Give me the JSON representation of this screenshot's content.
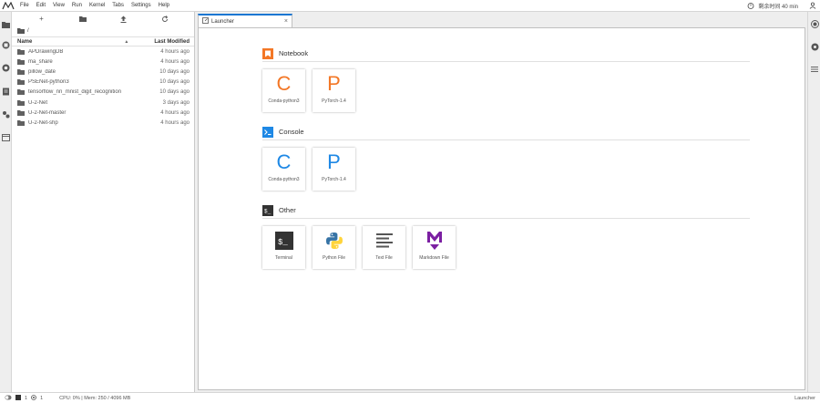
{
  "menubar": {
    "items": [
      "File",
      "Edit",
      "View",
      "Run",
      "Kernel",
      "Tabs",
      "Settings",
      "Help"
    ],
    "timer_text": "剩余时间 40 min"
  },
  "filebrowser": {
    "toolbar": {
      "new_launcher": "+",
      "new_folder": "new-folder-icon",
      "upload": "upload-icon",
      "refresh": "refresh-icon"
    },
    "breadcrumb": "/",
    "header": {
      "name": "Name",
      "modified": "Last Modified"
    },
    "rows": [
      {
        "name": "APDrawingDB",
        "modified": "4 hours ago"
      },
      {
        "name": "ma_share",
        "modified": "4 hours ago"
      },
      {
        "name": "pillow_date",
        "modified": "10 days ago"
      },
      {
        "name": "PSENet-python3",
        "modified": "10 days ago"
      },
      {
        "name": "tensorflow_nn_mnist_digit_recognition",
        "modified": "10 days ago"
      },
      {
        "name": "U-2-Net",
        "modified": "3 days ago"
      },
      {
        "name": "U-2-Net-master",
        "modified": "4 hours ago"
      },
      {
        "name": "U-2-Net-shp",
        "modified": "4 hours ago"
      }
    ]
  },
  "tab": {
    "label": "Launcher"
  },
  "launcher": {
    "notebook": {
      "title": "Notebook",
      "cards": [
        {
          "letter": "C",
          "label": "Conda-python3"
        },
        {
          "letter": "P",
          "label": "PyTorch-1.4"
        }
      ]
    },
    "console": {
      "title": "Console",
      "cards": [
        {
          "letter": "C",
          "label": "Conda-python3"
        },
        {
          "letter": "P",
          "label": "PyTorch-1.4"
        }
      ]
    },
    "other": {
      "title": "Other",
      "cards": [
        {
          "label": "Terminal"
        },
        {
          "label": "Python File"
        },
        {
          "label": "Text File"
        },
        {
          "label": "Markdown File"
        }
      ]
    }
  },
  "statusbar": {
    "count1": "1",
    "count2": "1",
    "metrics": "CPU: 0% | Mem: 250 / 4096 MB",
    "mode": "Launcher"
  },
  "colors": {
    "notebook_orange": "#f37726",
    "console_blue": "#1e88e5",
    "markdown_purple": "#7b1fa2",
    "accent": "#1976d2"
  }
}
